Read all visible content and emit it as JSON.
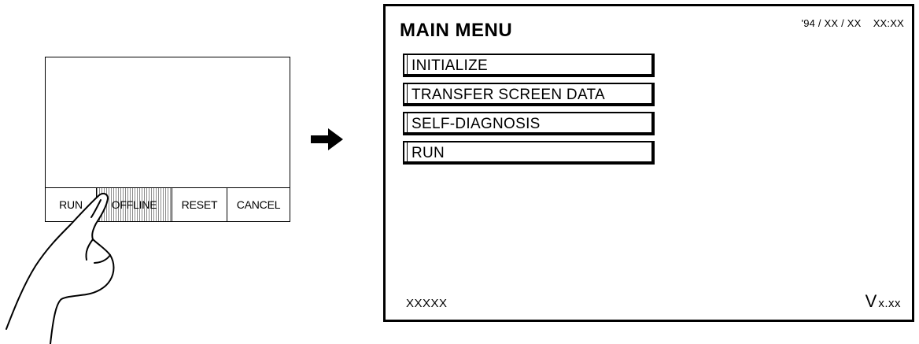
{
  "small_screen": {
    "buttons": [
      {
        "label": "RUN"
      },
      {
        "label": "OFFLINE"
      },
      {
        "label": "RESET"
      },
      {
        "label": "CANCEL"
      }
    ]
  },
  "main_screen": {
    "title": "MAIN MENU",
    "datetime": "'94 / XX / XX    XX:XX",
    "menu_items": [
      {
        "label": "INITIALIZE"
      },
      {
        "label": "TRANSFER SCREEN DATA"
      },
      {
        "label": "SELF-DIAGNOSIS"
      },
      {
        "label": "RUN"
      }
    ],
    "footer_left": "XXXXX",
    "version_prefix": "V",
    "version": "x.xx"
  },
  "icons": {
    "hand": "pointing-hand-icon",
    "arrow": "right-arrow-icon"
  },
  "colors": {
    "line": "#000000",
    "background": "#ffffff",
    "pressed_hatch": "#8c8c8c"
  }
}
